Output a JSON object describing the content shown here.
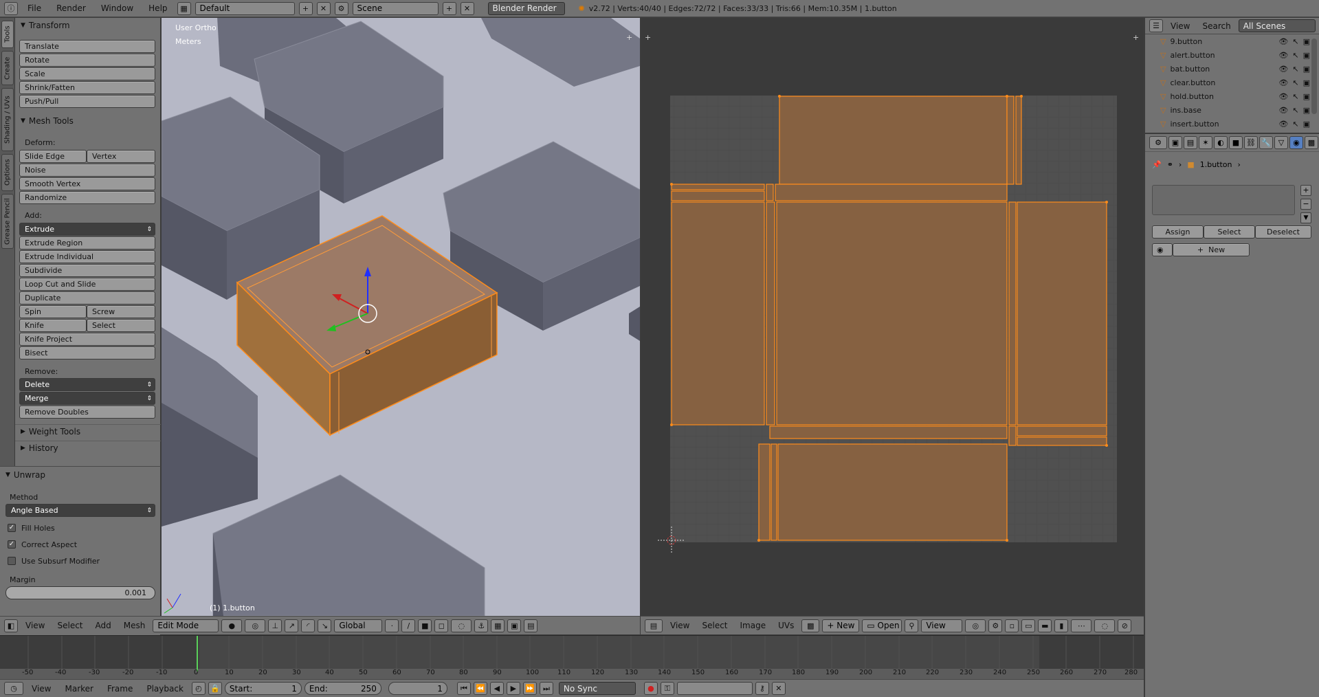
{
  "topbar": {
    "menus": [
      "File",
      "Render",
      "Window",
      "Help"
    ],
    "layout": "Default",
    "scene": "Scene",
    "engine": "Blender Render",
    "stats": "v2.72 | Verts:40/40 | Edges:72/72 | Faces:33/33 | Tris:66 | Mem:10.35M | 1.button"
  },
  "side_tabs": [
    "Tools",
    "Create",
    "Shading / UVs",
    "Options",
    "Grease Pencil"
  ],
  "transform": {
    "title": "Transform",
    "buttons": [
      "Translate",
      "Rotate",
      "Scale",
      "Shrink/Fatten",
      "Push/Pull"
    ]
  },
  "mesh_tools": {
    "title": "Mesh Tools",
    "deform_label": "Deform:",
    "slide_edge": "Slide Edge",
    "vertex": "Vertex",
    "noise": "Noise",
    "smooth_vertex": "Smooth Vertex",
    "randomize": "Randomize",
    "add_label": "Add:",
    "extrude": "Extrude",
    "extrude_region": "Extrude Region",
    "extrude_individual": "Extrude Individual",
    "subdivide": "Subdivide",
    "loop_cut": "Loop Cut and Slide",
    "duplicate": "Duplicate",
    "spin": "Spin",
    "screw": "Screw",
    "knife": "Knife",
    "select": "Select",
    "knife_project": "Knife Project",
    "bisect": "Bisect",
    "remove_label": "Remove:",
    "delete": "Delete",
    "merge": "Merge",
    "remove_doubles": "Remove Doubles"
  },
  "weight_tools": "Weight Tools",
  "history": "History",
  "unwrap": {
    "title": "Unwrap",
    "method_label": "Method",
    "method": "Angle Based",
    "fill_holes": "Fill Holes",
    "correct_aspect": "Correct Aspect",
    "use_subsurf": "Use Subsurf Modifier",
    "margin_label": "Margin",
    "margin": "0.001"
  },
  "viewport": {
    "view_name": "User Ortho",
    "units": "Meters",
    "object_label": "(1) 1.button",
    "header": {
      "view": "View",
      "select": "Select",
      "add": "Add",
      "mesh": "Mesh",
      "mode": "Edit Mode",
      "orientation": "Global"
    }
  },
  "uv_editor": {
    "header": {
      "view": "View",
      "select": "Select",
      "image": "Image",
      "uvs": "UVs",
      "new": "New",
      "open": "Open",
      "view2": "View"
    }
  },
  "outliner": {
    "view": "View",
    "search": "Search",
    "scenes": "All Scenes",
    "items": [
      "9.button",
      "alert.button",
      "bat.button",
      "clear.button",
      "hold.button",
      "ins.base",
      "insert.button"
    ]
  },
  "properties": {
    "object_name": "1.button",
    "assign": "Assign",
    "select": "Select",
    "deselect": "Deselect",
    "new": "New"
  },
  "timeline": {
    "ticks": [
      "-50",
      "-40",
      "-30",
      "-20",
      "-10",
      "0",
      "10",
      "20",
      "30",
      "40",
      "50",
      "60",
      "70",
      "80",
      "90",
      "100",
      "110",
      "120",
      "130",
      "140",
      "150",
      "160",
      "170",
      "180",
      "190",
      "200",
      "210",
      "220",
      "230",
      "240",
      "250",
      "260",
      "270",
      "280"
    ],
    "footer": {
      "view": "View",
      "marker": "Marker",
      "frame": "Frame",
      "playback": "Playback",
      "start_label": "Start:",
      "start": "1",
      "end_label": "End:",
      "end": "250",
      "current": "1",
      "sync": "No Sync"
    }
  },
  "colors": {
    "accent": "#ff8c1a",
    "uv_face": "#8b6340",
    "panel": "#727272",
    "button": "#9a9a9a"
  }
}
